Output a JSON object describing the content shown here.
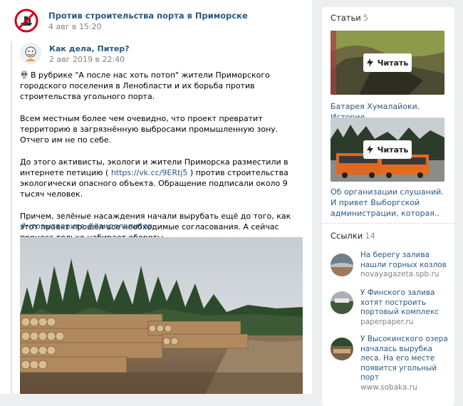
{
  "post": {
    "author": "Против строительства порта в Приморске",
    "date": "4 авг в 15:20",
    "repost": {
      "author": "Как дела, Питер?",
      "date": "2 авг 2019 в 22:40"
    },
    "paragraphs": [
      "В рубрике \"А после нас хоть потоп\" жители Приморского городского поселения в Ленобласти и их борьба против строительства угольного порта.",
      "Всем местным более чем очевидно, что проект превратит территорию в загрязнённую выбросами промышленную зону. Отчего им не по себе.",
      "Причем, зелёные насаждения начали вырубать ещё до того, как этот проект прошёл все необходимые согласования. А сейчас процесс только набирает обороты..."
    ],
    "petition": {
      "before": "До этого активисты, экологи и жители Приморска разместили в интернете петицию ( ",
      "link": "https://vk.cc/9ERtj5",
      "after": " ) против строительства экологически опасного объекта. Обращение подписали около 9 тысяч человек."
    },
    "hashtags": "#чтовытворите #какделапитер"
  },
  "sidebar": {
    "articles": {
      "title": "Статьи",
      "count": "5",
      "read_label": "Читать",
      "items": [
        {
          "caption": "Батарея Хумалайоки. История"
        },
        {
          "caption": "Об организации слушаний. И привет Выборгской администрации, которая.."
        }
      ]
    },
    "links": {
      "title": "Ссылки",
      "count": "14",
      "items": [
        {
          "title": "На берегу залива нашли горных козлов",
          "domain": "novayagazeta.spb.ru"
        },
        {
          "title": "У Финского залива хотят построить портовый комплекс",
          "domain": "paperpaper.ru"
        },
        {
          "title": "У Высокинского озера началась вырубка леса. На его месте появится угольный порт",
          "domain": "www.sobaka.ru"
        }
      ]
    }
  }
}
